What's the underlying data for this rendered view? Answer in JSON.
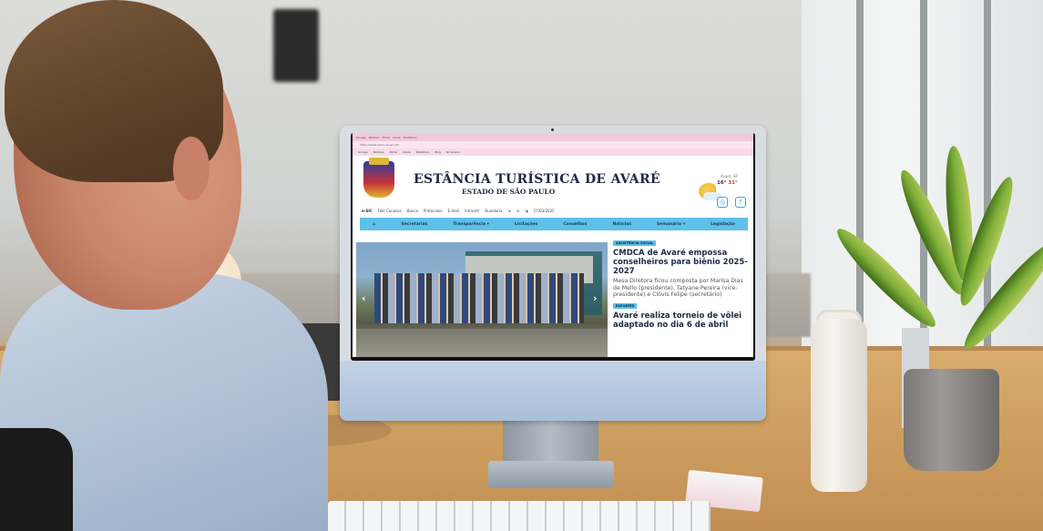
{
  "browser": {
    "address": "https://www.avare.sp.gov.br/",
    "bookmarks": [
      "Google",
      "Notícias",
      "Portal",
      "Avaré",
      "Prefeitura",
      "Blog",
      "Dicionário"
    ]
  },
  "site": {
    "title": "ESTÂNCIA TURÍSTICA DE AVARÉ",
    "subtitle": "ESTADO DE SÃO PAULO",
    "weather_city": "Avaré, SP",
    "temp_low": "16°",
    "temp_high": "31°",
    "toolbar": {
      "esic": "e-SIC",
      "fale": "Fale Conosco",
      "busca": "Busca",
      "protocolos": "Protocolos",
      "email": "E-mail",
      "intranet": "Intranet",
      "ouvidoria": "Ouvidoria",
      "date": "27/03/2025"
    },
    "nav": [
      "Secretarias",
      "Transparência ▾",
      "Licitações",
      "Conselhos",
      "Notícias",
      "Semanário ▾",
      "Legislação"
    ],
    "news": [
      {
        "tag": "ASSISTÊNCIA SOCIAL",
        "headline": "CMDCA de Avaré empossa conselheiros para biênio 2025-2027",
        "summary": "Mesa Diretora ficou composta por Marisa Dias de Mello (presidente), Tatyane Pereira (vice-presidente) e Clóvis Felipe (secretário)"
      },
      {
        "tag": "ESPORTES",
        "headline": "Avaré realiza torneio de vôlei adaptado no dia 6 de abril"
      }
    ]
  },
  "colors": {
    "nav_bg": "#5ec0e8",
    "title": "#1d2a44",
    "browser_tab": "#f3c9dd"
  },
  "icons": {
    "home": "home-icon",
    "instagram": "instagram-icon",
    "facebook": "facebook-icon",
    "zoom_in": "zoom-in-icon",
    "zoom_out": "zoom-out-icon",
    "contrast": "contrast-icon",
    "calendar": "calendar-icon",
    "arrow_left": "chevron-left-icon",
    "arrow_right": "chevron-right-icon"
  }
}
